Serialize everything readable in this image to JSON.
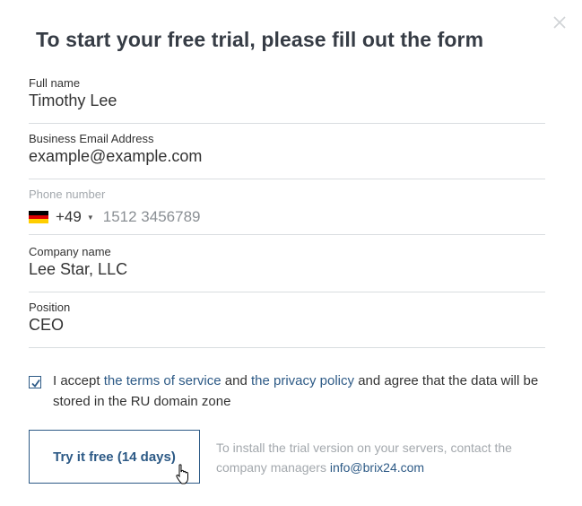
{
  "modal": {
    "title": "To start your free trial, please fill out the form",
    "close_icon": "close-icon"
  },
  "form": {
    "full_name": {
      "label": "Full name",
      "value": "Timothy Lee"
    },
    "email": {
      "label": "Business Email Address",
      "value": "example@example.com"
    },
    "phone": {
      "label": "Phone number",
      "country_flag": "germany-flag",
      "flag_colors": [
        "#000000",
        "#dd0000",
        "#ffce00"
      ],
      "dial_code": "+49",
      "placeholder": "1512 3456789"
    },
    "company": {
      "label": "Company name",
      "value": "Lee Star, LLC"
    },
    "position": {
      "label": "Position",
      "value": "CEO"
    }
  },
  "consent": {
    "checked": true,
    "text_1": "I accept ",
    "terms_link": "the terms of service",
    "text_2": " and ",
    "privacy_link": "the privacy policy",
    "text_3": " and agree that the data will be stored in the RU domain zone"
  },
  "cta": {
    "label": "Try it free (14 days)"
  },
  "note": {
    "text": "To install the trial version on your servers, contact the company managers ",
    "email": "info@brix24.com"
  },
  "colors": {
    "accent": "#2d5a86",
    "title": "#363c45",
    "muted": "#a3a8ad",
    "divider": "#d9dde0"
  }
}
